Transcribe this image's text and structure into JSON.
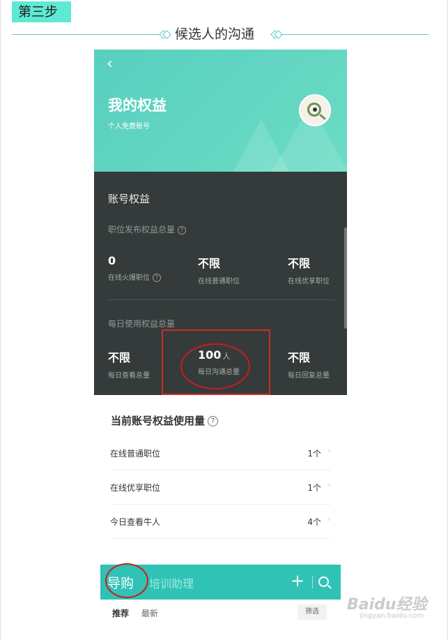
{
  "header": {
    "step_label": "第三步",
    "section_title": "候选人的沟通"
  },
  "phone": {
    "back_icon": "chevron-left-icon",
    "hero": {
      "title": "我的权益",
      "subtitle": "个人免费账号"
    },
    "account": {
      "heading": "账号权益",
      "post_quota_label": "职位发布权益总量",
      "post_quota": [
        {
          "value": "0",
          "caption": "在线火爆职位",
          "has_help": true
        },
        {
          "value": "不限",
          "caption": "在线普通职位",
          "has_help": false
        },
        {
          "value": "不限",
          "caption": "在线优享职位",
          "has_help": false
        }
      ],
      "daily_quota_label": "每日使用权益总量",
      "daily_quota": [
        {
          "value": "不限",
          "unit": "",
          "caption": "每日查看总量"
        },
        {
          "value": "100",
          "unit": "人",
          "caption": "每日沟通总量"
        },
        {
          "value": "不限",
          "unit": "",
          "caption": "每日回复总量"
        }
      ]
    },
    "usage": {
      "title": "当前账号权益使用量",
      "rows": [
        {
          "label": "在线普通职位",
          "value": "1个"
        },
        {
          "label": "在线优享职位",
          "value": "1个"
        },
        {
          "label": "今日查看牛人",
          "value": "4个"
        }
      ]
    },
    "tabbar": {
      "tab_active": "导购",
      "tab_other": "培训助理",
      "plus_icon": "plus-icon",
      "search_icon": "search-icon"
    },
    "subtabs": {
      "recommend": "推荐",
      "latest": "最新",
      "filter": "筛选"
    }
  },
  "watermark": {
    "text": "Baidu经验",
    "url": "jingyan.baidu.com"
  },
  "colors": {
    "badge": "#5ee9d5",
    "hero": "#5dd4c0",
    "dark_panel": "#353b3a",
    "tabbar": "#2fc2b5",
    "annotation": "#d02a2a"
  }
}
